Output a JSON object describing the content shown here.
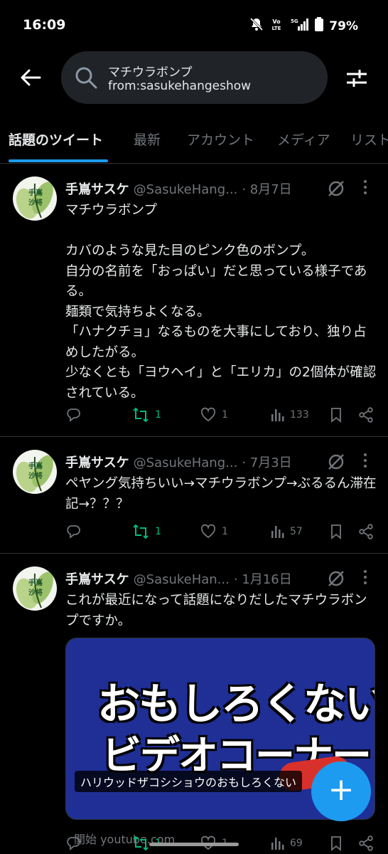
{
  "status": {
    "time": "16:09",
    "battery": "79%",
    "volte": "Vo LTE",
    "network": "5G",
    "icons": [
      "mute-icon",
      "volte-icon",
      "signal-icon",
      "battery-icon"
    ]
  },
  "search": {
    "line1": "マチウラボンプ",
    "line2": "from:sasukehangeshow"
  },
  "tabs": [
    {
      "label": "話題のツイート"
    },
    {
      "label": "最新"
    },
    {
      "label": "アカウント"
    },
    {
      "label": "メディア"
    },
    {
      "label": "リスト"
    }
  ],
  "avatar_text": [
    "手嶌",
    "沙将"
  ],
  "tweets": [
    {
      "name": "手嶌サスケ",
      "handle": "@SasukeHang...",
      "date": "· 8月7日",
      "text": "マチウラボンプ\n\nカバのような見た目のピンク色のボンプ。\n自分の名前を「おっぱい」だと思っている様子である。\n麺類で気持ちよくなる。\n「ハナクチョ」なるものを大事にしており、独り占めしたがる。\n少なくとも「ヨウヘイ」と「エリカ」の2個体が確認されている。",
      "retweets": "1",
      "likes": "1",
      "views": "133"
    },
    {
      "name": "手嶌サスケ",
      "handle": "@SasukeHang...",
      "date": "· 7月3日",
      "text": "ペヤング気持ちいい→マチウラボンプ→ぶるるん滞在記→？？？",
      "retweets": "1",
      "likes": "1",
      "views": "57"
    },
    {
      "name": "手嶌サスケ",
      "handle": "@SasukeHan...",
      "date": "· 1月16日",
      "text": "これが最近になって話題になりだしたマチウラボンプですか。",
      "retweets": "1",
      "likes": "1",
      "views": "69",
      "card": {
        "title_line1": "おもしろくない",
        "title_line2": "ビデオコーナー",
        "caption": "ハリウッドザコシショウのおもしろくない",
        "source": "開始 youtube.com"
      }
    }
  ],
  "fab": {
    "label": "+"
  },
  "colors": {
    "accent": "#1d9bf0",
    "retweet": "#00ba7c",
    "muted": "#71767b",
    "background": "#000000"
  }
}
